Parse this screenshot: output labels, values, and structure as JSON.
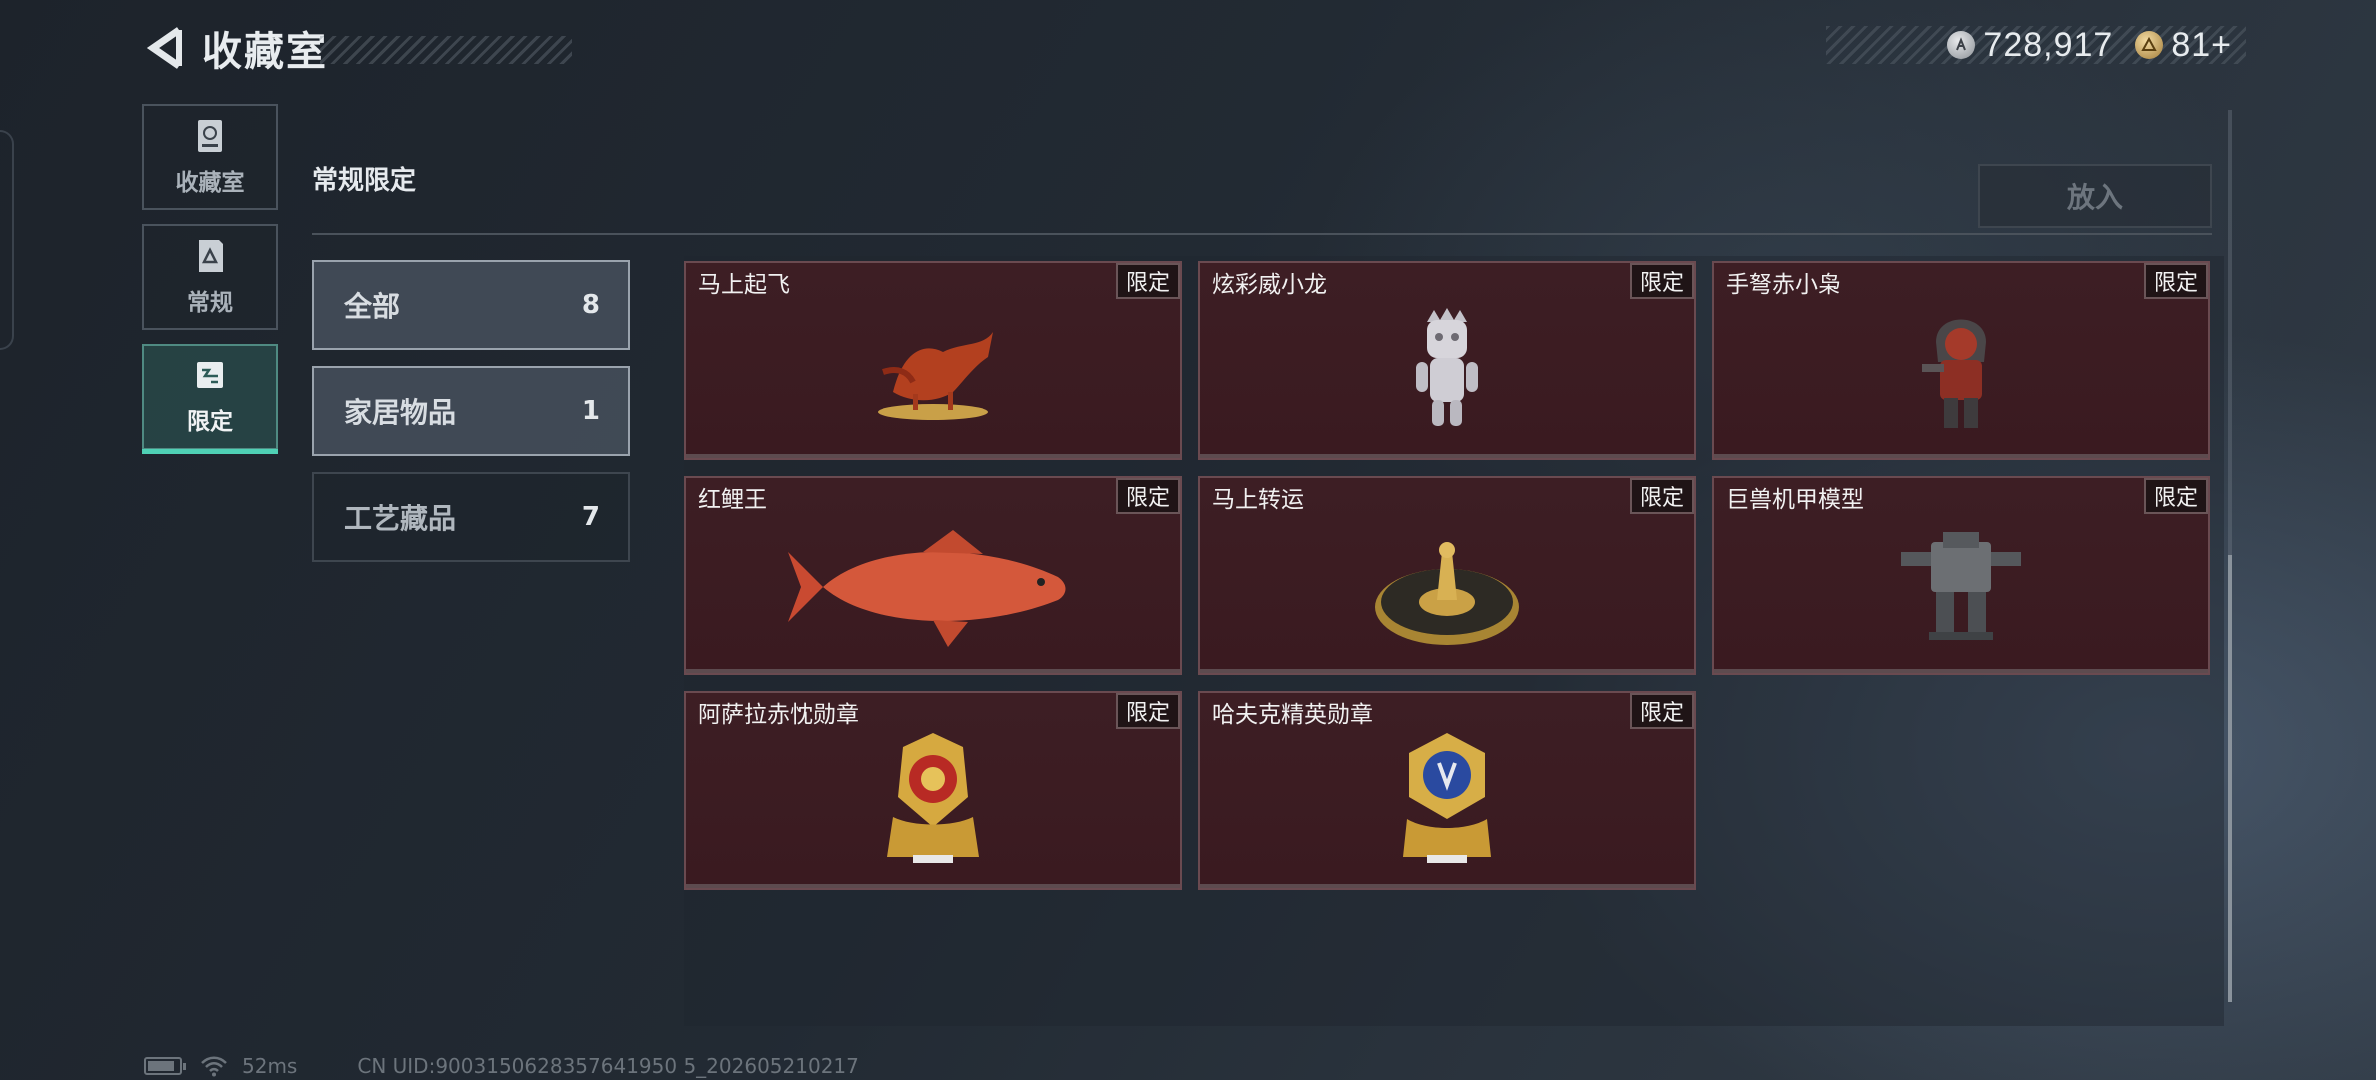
{
  "header": {
    "title": "收藏室"
  },
  "currency": {
    "silver": {
      "icon": "silver-coin-icon",
      "value": "728,917"
    },
    "gold": {
      "icon": "gold-coin-icon",
      "value": "81+"
    }
  },
  "nav": {
    "items": [
      {
        "label": "收藏室",
        "icon": "archive-icon"
      },
      {
        "label": "常规",
        "icon": "book-icon"
      },
      {
        "label": "限定",
        "icon": "limited-icon"
      }
    ],
    "active_index": 2
  },
  "section": {
    "title": "常规限定",
    "put_button": "放入"
  },
  "categories": [
    {
      "name": "全部",
      "count": "8"
    },
    {
      "name": "家居物品",
      "count": "1"
    },
    {
      "name": "工艺藏品",
      "count": "7"
    }
  ],
  "items": [
    {
      "name": "马上起飞",
      "badge": "限定",
      "icon": "horse-statue-icon"
    },
    {
      "name": "炫彩威小龙",
      "badge": "限定",
      "icon": "dragon-figure-icon"
    },
    {
      "name": "手弩赤小枭",
      "badge": "限定",
      "icon": "hooded-figure-icon"
    },
    {
      "name": "红鲤王",
      "badge": "限定",
      "icon": "carp-fish-icon"
    },
    {
      "name": "马上转运",
      "badge": "限定",
      "icon": "fortune-wheel-icon"
    },
    {
      "name": "巨兽机甲模型",
      "badge": "限定",
      "icon": "mech-model-icon"
    },
    {
      "name": "阿萨拉赤忱勋章",
      "badge": "限定",
      "icon": "red-medal-icon"
    },
    {
      "name": "哈夫克精英勋章",
      "badge": "限定",
      "icon": "blue-medal-icon"
    }
  ],
  "status": {
    "ping": "52ms",
    "uid": "CN UID:9003150628357641950 5_202605210217"
  },
  "colors": {
    "accent": "#4fd1b5",
    "card_bg": "#3d1e24",
    "background": "#232a33"
  }
}
